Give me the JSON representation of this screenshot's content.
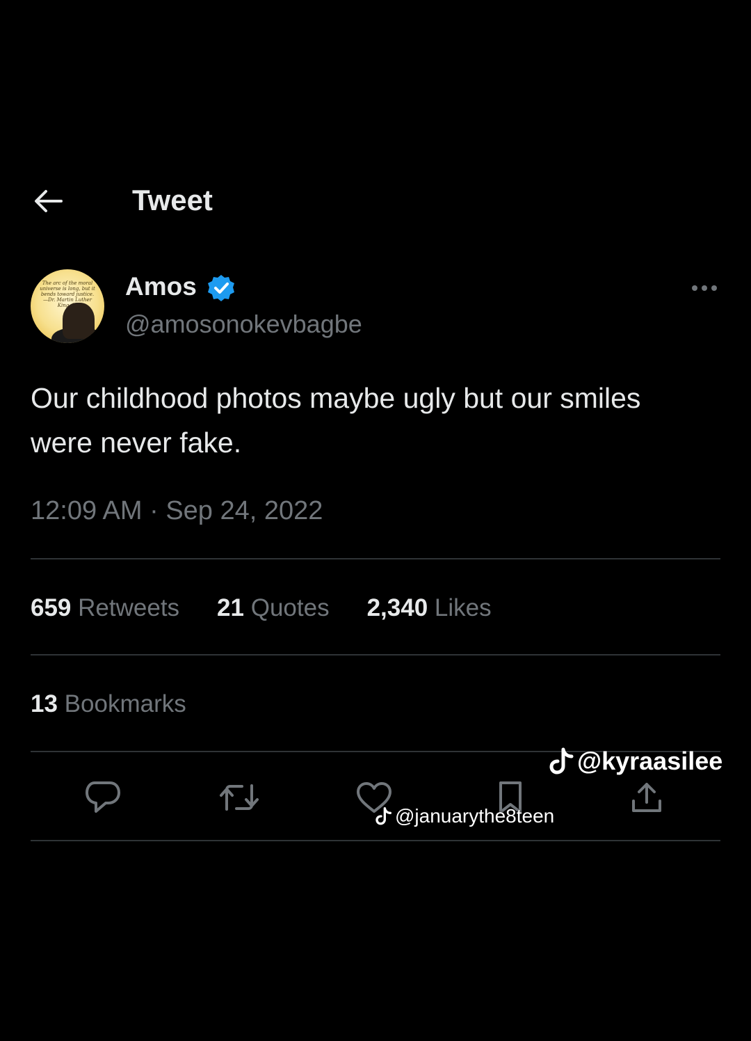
{
  "header": {
    "back_icon": "arrow-left-icon",
    "title": "Tweet"
  },
  "author": {
    "display_name": "Amos",
    "verified_icon": "verified-badge-icon",
    "handle": "@amosonokevbagbe",
    "avatar_quote": "The arc of the moral universe is long, but it bends toward justice. —Dr. Martin Luther King, Jr."
  },
  "tweet": {
    "text_line1": "Our childhood photos maybe ugly but our smiles",
    "text_line2": "were never fake.",
    "timestamp": "12:09 AM · Sep 24, 2022"
  },
  "stats": {
    "retweets_count": "659",
    "retweets_label": "Retweets",
    "quotes_count": "21",
    "quotes_label": "Quotes",
    "likes_count": "2,340",
    "likes_label": "Likes",
    "bookmarks_count": "13",
    "bookmarks_label": "Bookmarks"
  },
  "actions": {
    "reply_icon": "reply-icon",
    "retweet_icon": "retweet-icon",
    "like_icon": "heart-icon",
    "bookmark_icon": "bookmark-icon",
    "share_icon": "share-icon"
  },
  "watermarks": {
    "top": "@kyraasilee",
    "middle": "@januarythe8teen"
  },
  "colors": {
    "background": "#000000",
    "primary_text": "#e7e9ea",
    "secondary_text": "#71767b",
    "divider": "#2f3336",
    "verified_blue": "#1d9bf0"
  }
}
